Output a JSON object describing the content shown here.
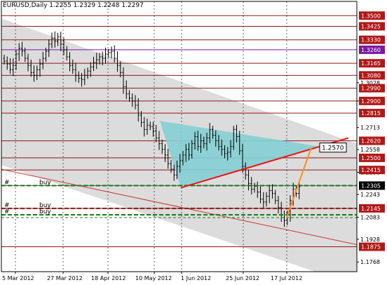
{
  "window": {
    "symbol_timeframe": "EURUSD,Daily",
    "ohlc": "1.2255 1.2329 1.2248 1.2297"
  },
  "price_axis": {
    "range": [
      1.17,
      1.36
    ],
    "grid_labels": [
      "1.3028",
      "1.2900",
      "1.2713",
      "1.2558",
      "1.2398",
      "1.2243",
      "1.2083",
      "1.1928",
      "1.1768"
    ],
    "level_labels": [
      {
        "value": 1.35,
        "text": "1.3500",
        "kind": "resistance"
      },
      {
        "value": 1.3425,
        "text": "1.3425",
        "kind": "resistance"
      },
      {
        "value": 1.333,
        "text": "1.3330",
        "kind": "resistance"
      },
      {
        "value": 1.326,
        "text": "1.3260",
        "kind": "pivot"
      },
      {
        "value": 1.3165,
        "text": "1.3165",
        "kind": "resistance"
      },
      {
        "value": 1.308,
        "text": "1.3080",
        "kind": "resistance"
      },
      {
        "value": 1.299,
        "text": "1.2990",
        "kind": "resistance"
      },
      {
        "value": 1.29,
        "text": "1.2900",
        "kind": "resistance"
      },
      {
        "value": 1.2815,
        "text": "1.2815",
        "kind": "resistance"
      },
      {
        "value": 1.262,
        "text": "1.2620",
        "kind": "resistance"
      },
      {
        "value": 1.25,
        "text": "1.2500",
        "kind": "resistance"
      },
      {
        "value": 1.2415,
        "text": "1.2415",
        "kind": "resistance"
      },
      {
        "value": 1.2305,
        "text": "1.2305",
        "kind": "current"
      },
      {
        "value": 1.2145,
        "text": "1.2145",
        "kind": "resistance"
      },
      {
        "value": 1.1875,
        "text": "1.1875",
        "kind": "resistance"
      }
    ]
  },
  "date_axis": {
    "labels": [
      "5 Mar 2012",
      "27 Mar 2012",
      "18 Apr 2012",
      "10 May 2012",
      "1 Jun 2012",
      "25 Jun 2012",
      "17 Jul 2012"
    ]
  },
  "target_label": "1.2570",
  "order_lines": [
    {
      "marker": "#",
      "label": "buy",
      "price": 1.2305,
      "color": "#1a7a1a"
    },
    {
      "marker": "#",
      "label": "buy",
      "price": 1.2145,
      "color": "#8b1a1a"
    },
    {
      "marker": "#",
      "label": "buy",
      "price": 1.21,
      "color": "#1a7a1a"
    }
  ],
  "colors": {
    "background": "#ffffff",
    "channel": "#dcdcdc",
    "triangle": "#84cfd3",
    "level_line": "#8b1a1a",
    "level_label_bg": "#b01818",
    "pivot_label_bg": "#7a1aa0",
    "current_label_bg": "#000000",
    "trendline": "#ee1111",
    "projection": "#ff8c1a",
    "candle": "#000000"
  },
  "chart_data": {
    "type": "candlestick",
    "title": "EURUSD,Daily",
    "xlabel": "",
    "ylabel": "",
    "ylim": [
      1.17,
      1.36
    ],
    "x_tick_labels": [
      "5 Mar 2012",
      "27 Mar 2012",
      "18 Apr 2012",
      "10 May 2012",
      "1 Jun 2012",
      "25 Jun 2012",
      "17 Jul 2012"
    ],
    "last_bar": {
      "open": 1.2255,
      "high": 1.2329,
      "low": 1.2248,
      "close": 1.2297
    },
    "closes": [
      1.318,
      1.316,
      1.312,
      1.315,
      1.323,
      1.327,
      1.325,
      1.32,
      1.315,
      1.31,
      1.308,
      1.312,
      1.316,
      1.32,
      1.325,
      1.33,
      1.334,
      1.332,
      1.335,
      1.33,
      1.326,
      1.321,
      1.315,
      1.312,
      1.308,
      1.306,
      1.305,
      1.308,
      1.311,
      1.314,
      1.317,
      1.319,
      1.321,
      1.32,
      1.323,
      1.324,
      1.325,
      1.32,
      1.315,
      1.31,
      1.3,
      1.295,
      1.292,
      1.29,
      1.287,
      1.28,
      1.275,
      1.27,
      1.273,
      1.272,
      1.269,
      1.264,
      1.26,
      1.256,
      1.252,
      1.246,
      1.242,
      1.238,
      1.244,
      1.248,
      1.252,
      1.256,
      1.252,
      1.26,
      1.265,
      1.258,
      1.262,
      1.26,
      1.264,
      1.27,
      1.266,
      1.262,
      1.258,
      1.256,
      1.253,
      1.254,
      1.258,
      1.27,
      1.265,
      1.255,
      1.244,
      1.238,
      1.232,
      1.228,
      1.23,
      1.226,
      1.221,
      1.219,
      1.223,
      1.227,
      1.225,
      1.22,
      1.215,
      1.208,
      1.206,
      1.21,
      1.22,
      1.228,
      1.225,
      1.2297
    ],
    "horizontal_levels": [
      1.35,
      1.3425,
      1.333,
      1.326,
      1.3165,
      1.308,
      1.299,
      1.29,
      1.2815,
      1.262,
      1.25,
      1.2415,
      1.2305,
      1.2145,
      1.1875
    ],
    "triangle_vertices": [
      {
        "bar": 54,
        "price": 1.229
      },
      {
        "bar": 52,
        "price": 1.276
      },
      {
        "bar": 98,
        "price": 1.258
      }
    ],
    "projection_target": 1.257
  }
}
